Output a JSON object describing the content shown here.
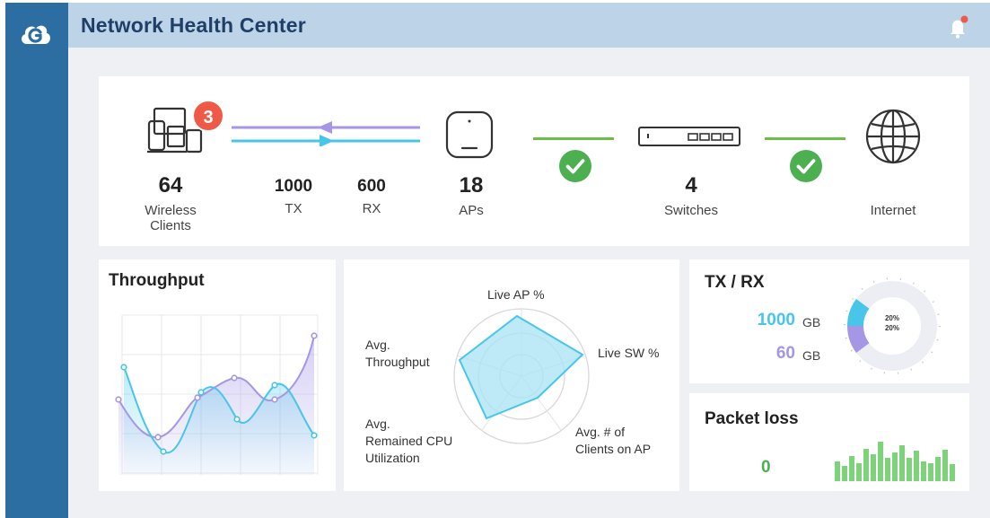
{
  "header": {
    "title": "Network Health Center"
  },
  "topology": {
    "wireless_clients": {
      "count": "64",
      "label_line1": "Wireless",
      "label_line2": "Clients",
      "badge": "3"
    },
    "tx": {
      "value": "1000",
      "label": "TX"
    },
    "rx": {
      "value": "600",
      "label": "RX"
    },
    "aps": {
      "count": "18",
      "label": "APs"
    },
    "switches": {
      "count": "4",
      "label": "Switches"
    },
    "internet": {
      "label": "Internet"
    }
  },
  "throughput": {
    "title": "Throughput"
  },
  "radar": {
    "labels": {
      "live_ap": "Live AP %",
      "live_sw": "Live SW %",
      "clients_line1": "Avg. # of",
      "clients_line2": "Clients on AP",
      "cpu_line1": "Avg.",
      "cpu_line2": "Remained CPU",
      "cpu_line3": "Utilization",
      "thr_line1": "Avg.",
      "thr_line2": "Throughput"
    }
  },
  "txrx": {
    "title": "TX / RX",
    "tx_value": "1000",
    "tx_unit": "GB",
    "rx_value": "60",
    "rx_unit": "GB",
    "donut_tx_pct": "20%",
    "donut_rx_pct": "20%"
  },
  "packet_loss": {
    "title": "Packet loss",
    "value": "0"
  },
  "colors": {
    "sidebar": "#2c6ea2",
    "header": "#bcd3e8",
    "title_text": "#1f3f66",
    "cyan": "#47c6ea",
    "purple": "#a596e6",
    "green": "#4caf50",
    "badge": "#ef5a47"
  }
}
